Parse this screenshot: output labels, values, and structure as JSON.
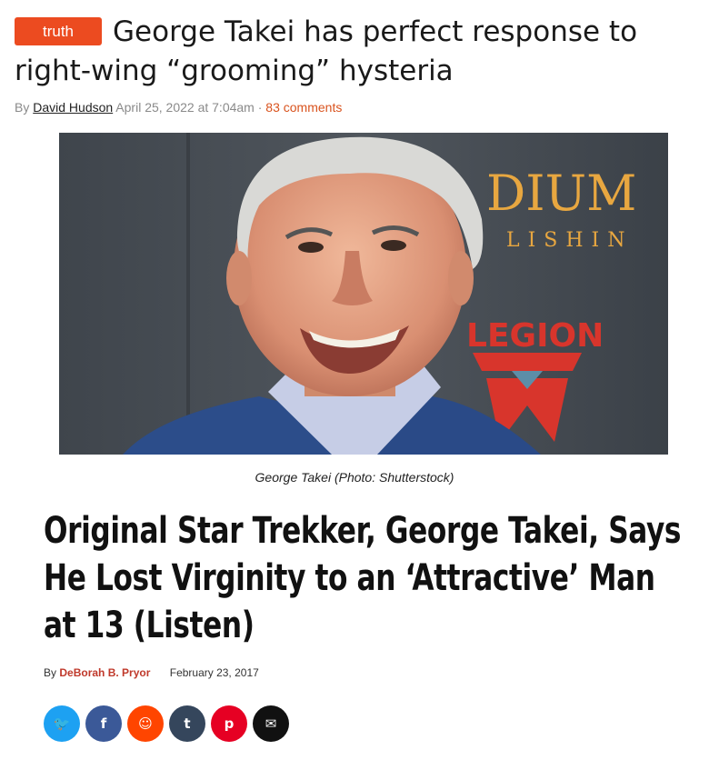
{
  "article": {
    "tag": "truth",
    "title": "George Takei has perfect response to right-wing “grooming” hysteria",
    "by_prefix": "By",
    "author": "David Hudson",
    "date": "April 25, 2022 at 7:04am",
    "separator": "·",
    "comments": "83 comments",
    "photo_caption": "George Takei (Photo: Shutterstock)",
    "photo_backdrop_text": {
      "line1": "DIUM",
      "line2": "LISHIN",
      "brand": "LEGION"
    }
  },
  "embedded": {
    "title": "Original Star Trekker, George Takei, Says He Lost Virginity to an ‘Attractive’ Man at 13 (Listen)",
    "by_prefix": "By",
    "author": "DeBorah B. Pryor",
    "date": "February 23, 2017"
  },
  "share_buttons": [
    {
      "icon": "twitter-icon",
      "glyph": "🐦",
      "color": "#1da1f2"
    },
    {
      "icon": "facebook-icon",
      "glyph": "f",
      "color": "#3b5998"
    },
    {
      "icon": "reddit-icon",
      "glyph": "☺",
      "color": "#ff4500"
    },
    {
      "icon": "tumblr-icon",
      "glyph": "t",
      "color": "#35465c"
    },
    {
      "icon": "pinterest-icon",
      "glyph": "p",
      "color": "#e60023"
    },
    {
      "icon": "email-icon",
      "glyph": "✉",
      "color": "#111111"
    }
  ],
  "colors": {
    "accent": "#ec4b20",
    "comments": "#d9531e"
  }
}
